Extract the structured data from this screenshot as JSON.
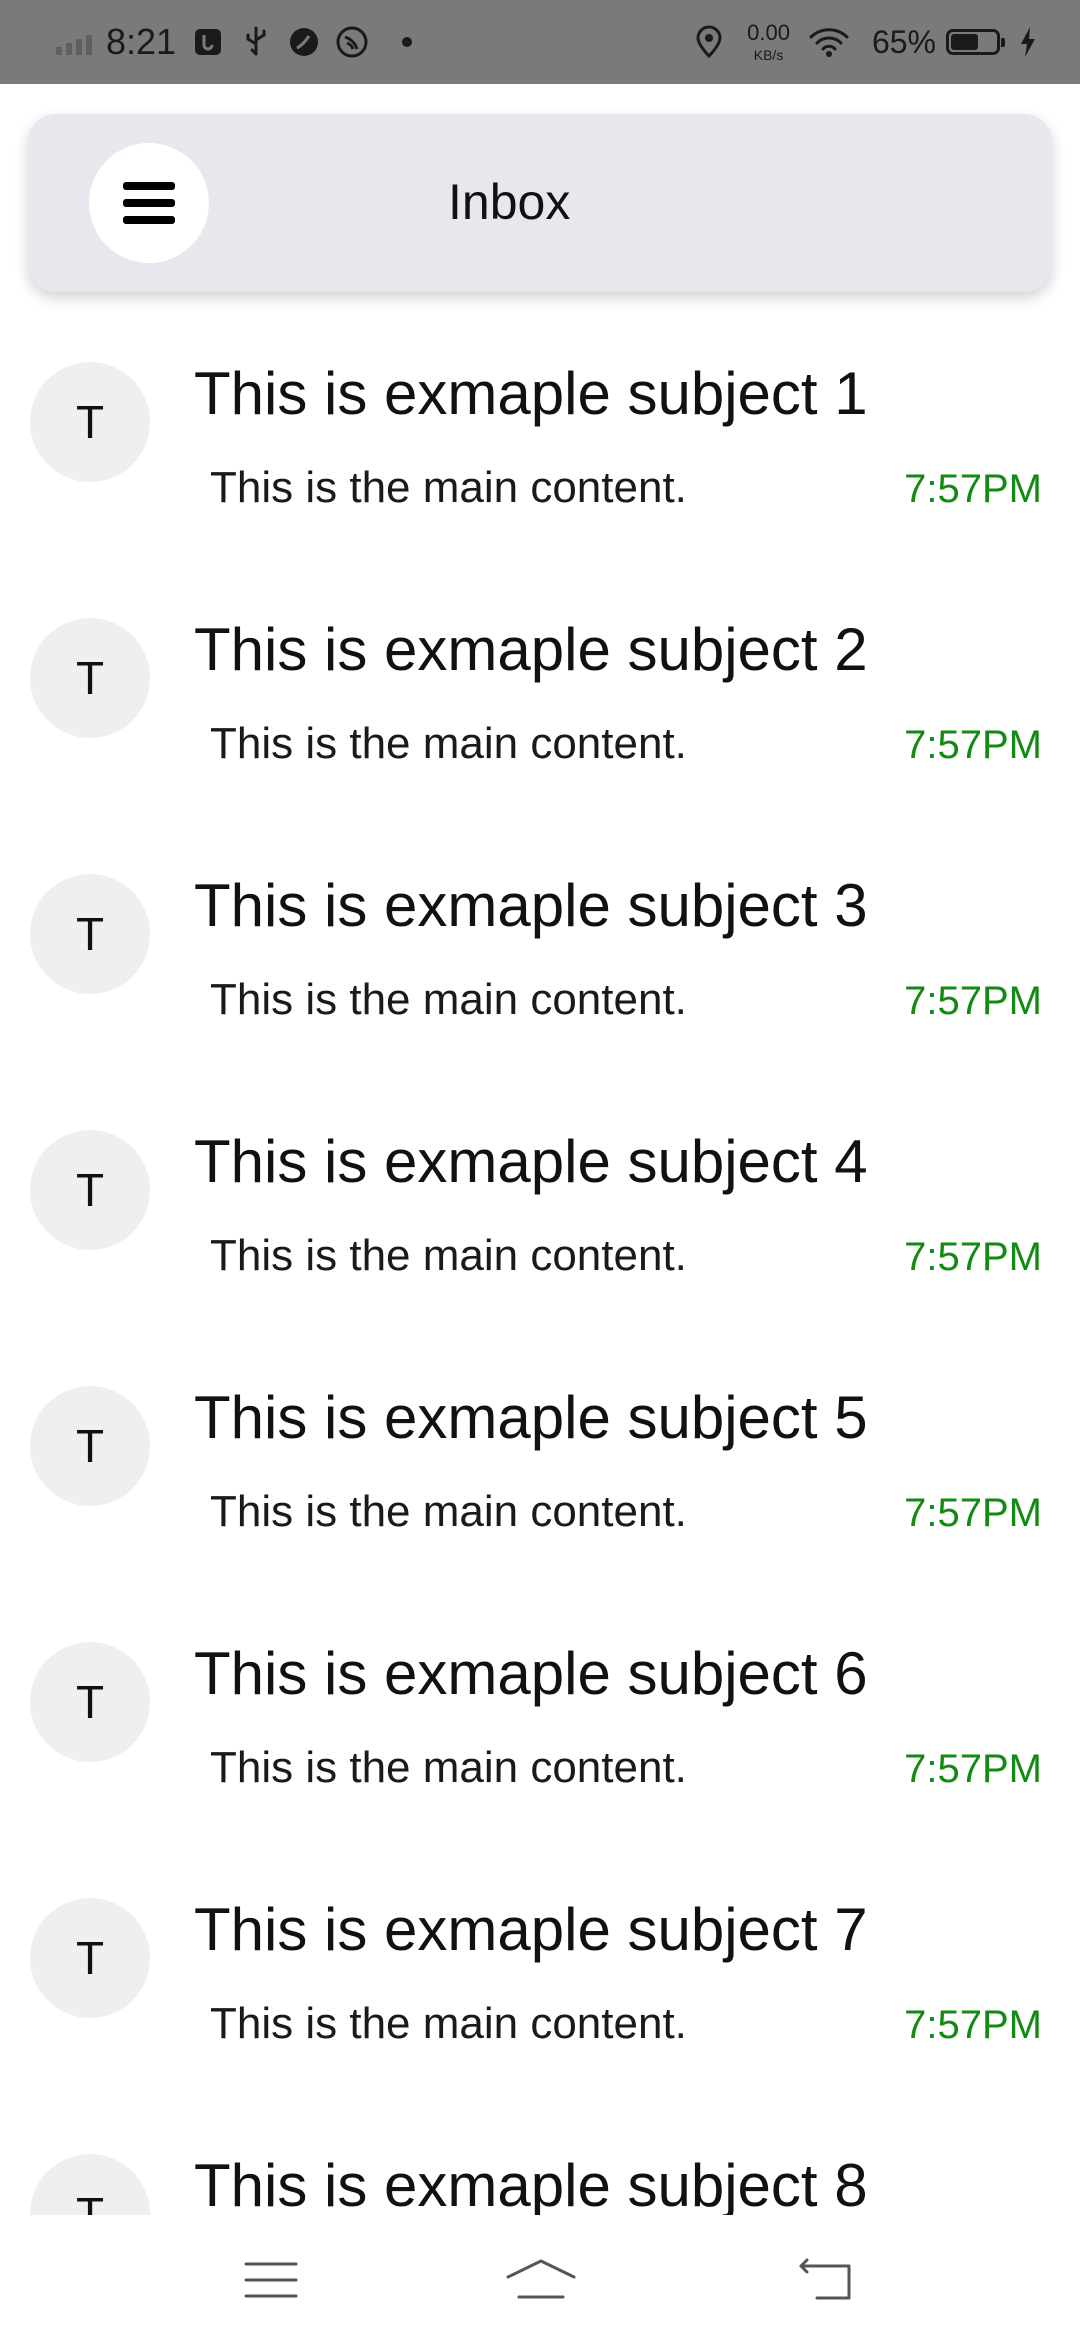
{
  "status_bar": {
    "time": "8:21",
    "network_speed": "0.00",
    "network_unit": "KB/s",
    "battery_percent": "65%",
    "battery_level": 0.65,
    "icons": [
      "signal-icon",
      "usb-debug-icon",
      "usb-icon",
      "app-icon",
      "nfc-icon",
      "notification-dot",
      "location-icon",
      "wifi-icon",
      "battery-icon",
      "charging-icon"
    ]
  },
  "app_bar": {
    "title": "Inbox",
    "menu_icon": "hamburger-menu-icon",
    "background": "#e7e8ee"
  },
  "time_color": "#138a13",
  "emails": [
    {
      "avatar": "T",
      "subject": "This is exmaple subject 1",
      "preview": "This is the main content.",
      "time": "7:57PM"
    },
    {
      "avatar": "T",
      "subject": "This is exmaple subject 2",
      "preview": "This is the main content.",
      "time": "7:57PM"
    },
    {
      "avatar": "T",
      "subject": "This is exmaple subject 3",
      "preview": "This is the main content.",
      "time": "7:57PM"
    },
    {
      "avatar": "T",
      "subject": "This is exmaple subject 4",
      "preview": "This is the main content.",
      "time": "7:57PM"
    },
    {
      "avatar": "T",
      "subject": "This is exmaple subject 5",
      "preview": "This is the main content.",
      "time": "7:57PM"
    },
    {
      "avatar": "T",
      "subject": "This is exmaple subject 6",
      "preview": "This is the main content.",
      "time": "7:57PM"
    },
    {
      "avatar": "T",
      "subject": "This is exmaple subject 7",
      "preview": "This is the main content.",
      "time": "7:57PM"
    },
    {
      "avatar": "T",
      "subject": "This is exmaple subject 8",
      "preview": "",
      "time": ""
    }
  ],
  "nav_bar": {
    "buttons": [
      "recent-apps-icon",
      "home-icon",
      "back-icon"
    ]
  }
}
